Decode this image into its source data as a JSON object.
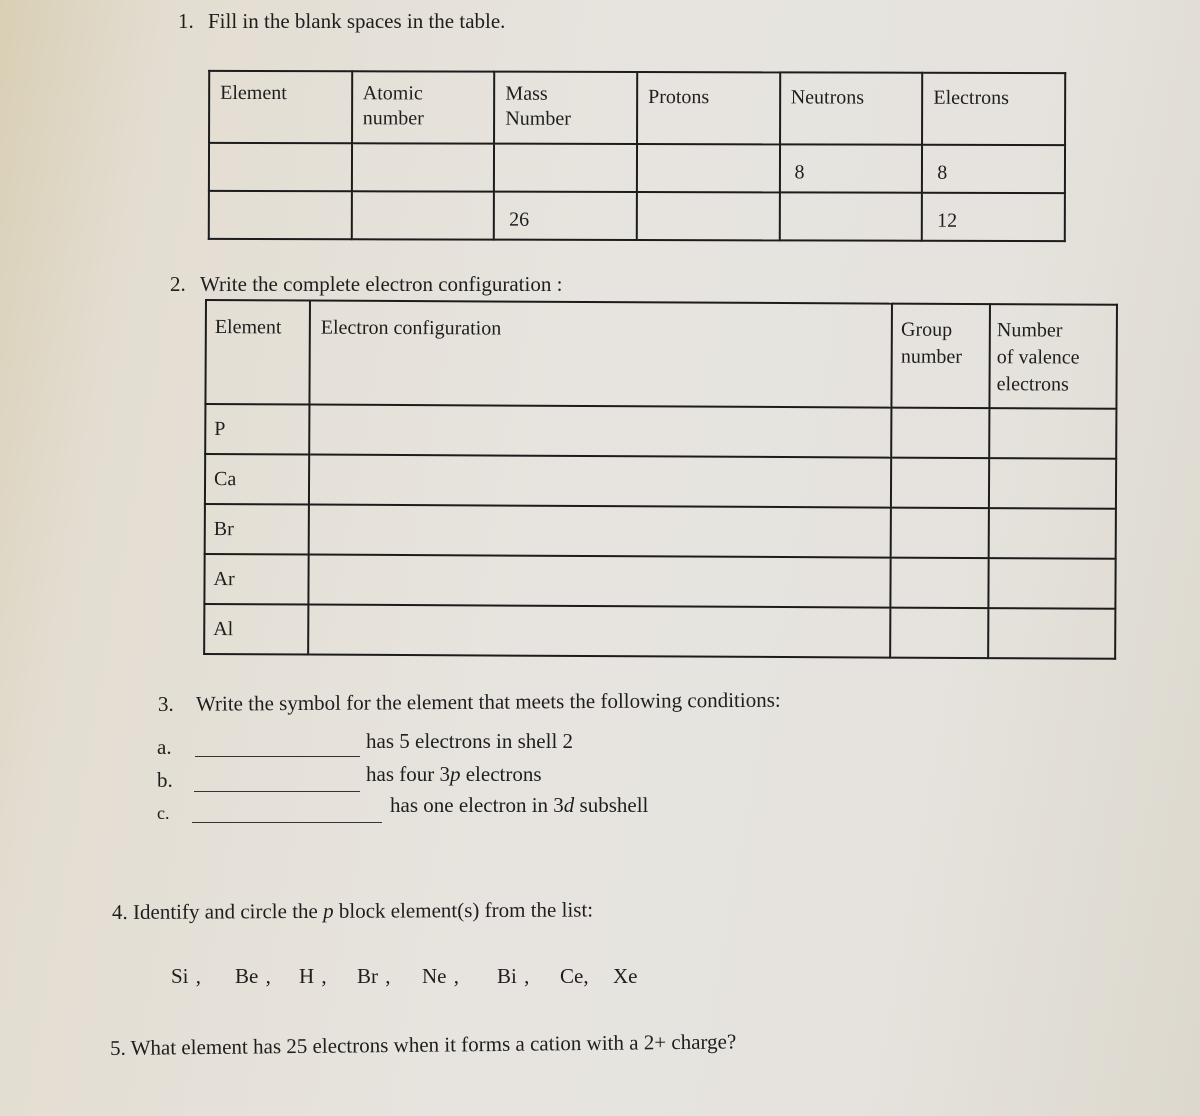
{
  "q1": {
    "number": "1.",
    "text": "Fill in the blank spaces in the table.",
    "headers": [
      [
        "Element",
        ""
      ],
      [
        "Atomic",
        "number"
      ],
      [
        "Mass",
        "Number"
      ],
      [
        "Protons",
        ""
      ],
      [
        "Neutrons",
        ""
      ],
      [
        "Electrons",
        ""
      ]
    ],
    "rows": [
      [
        "",
        "",
        "",
        "",
        "8",
        "8"
      ],
      [
        "",
        "",
        "26",
        "",
        "",
        "12"
      ]
    ]
  },
  "q2": {
    "number": "2.",
    "text": "Write the complete electron configuration :",
    "headers": {
      "element": "Element",
      "config": "Electron configuration",
      "group": [
        "Group",
        "number"
      ],
      "valence": [
        "Number",
        "of valence",
        "electrons"
      ]
    },
    "elements": [
      "P",
      "Ca",
      "Br",
      "Ar",
      "Al"
    ]
  },
  "q3": {
    "number": "3.",
    "text": "Write the symbol for the element that meets the following conditions:",
    "items": [
      {
        "label": "a.",
        "pre": "has 5 electrons in shell 2",
        "ital": "",
        "post": ""
      },
      {
        "label": "b.",
        "pre": "has four 3",
        "ital": "p",
        "post": " electrons"
      },
      {
        "label": "c.",
        "pre": "has one electron in 3",
        "ital": "d",
        "post": " subshell"
      }
    ]
  },
  "q4": {
    "text_pre": "4. Identify and circle  the ",
    "text_ital": "p",
    "text_post": " block element(s) from the list:",
    "elements": [
      "Si ,",
      "Be ,",
      "H ,",
      "Br ,",
      "Ne ,",
      "Bi ,",
      "Ce,",
      "Xe"
    ]
  },
  "q5": {
    "text": "5. What element has 25 electrons when it forms a cation with a 2+ charge?"
  }
}
